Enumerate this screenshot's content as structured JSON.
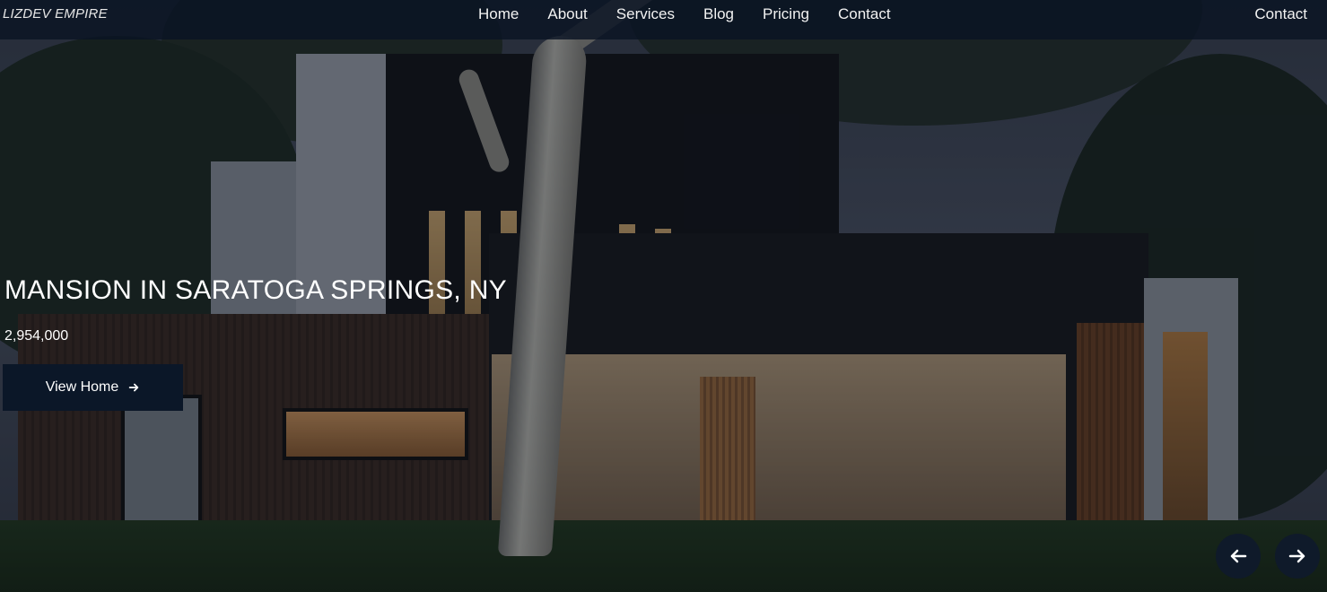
{
  "nav": {
    "brand": "LIZDEV EMPIRE",
    "links": [
      "Home",
      "About",
      "Services",
      "Blog",
      "Pricing",
      "Contact"
    ],
    "cta": "Contact"
  },
  "hero": {
    "title": "MANSION IN SARATOGA SPRINGS, NY",
    "price": "2,954,000",
    "button_label": "View Home",
    "button_icon": "arrow-right-icon",
    "prev_icon": "arrow-left-icon",
    "next_icon": "arrow-right-icon"
  },
  "colors": {
    "navbar": "#0a1423",
    "button": "#0b1728",
    "text": "#ffffff"
  }
}
